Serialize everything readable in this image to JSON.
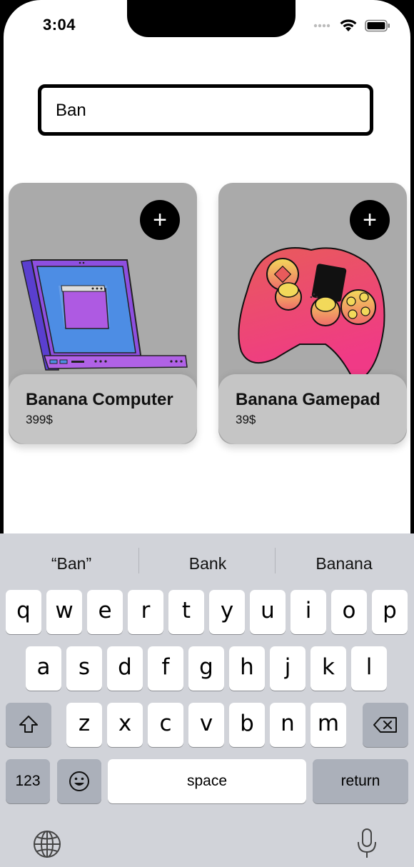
{
  "status_bar": {
    "time": "3:04"
  },
  "search": {
    "value": "Ban"
  },
  "products": [
    {
      "name": "Banana Computer",
      "price": "399$",
      "add_label": "+"
    },
    {
      "name": "Banana Gamepad",
      "price": "39$",
      "add_label": "+"
    }
  ],
  "keyboard": {
    "suggestions": [
      "“Ban”",
      "Bank",
      "Banana"
    ],
    "row1": [
      "q",
      "w",
      "e",
      "r",
      "t",
      "y",
      "u",
      "i",
      "o",
      "p"
    ],
    "row2": [
      "a",
      "s",
      "d",
      "f",
      "g",
      "h",
      "j",
      "k",
      "l"
    ],
    "row3": [
      "z",
      "x",
      "c",
      "v",
      "b",
      "n",
      "m"
    ],
    "numbers_label": "123",
    "space_label": "space",
    "return_label": "return"
  }
}
